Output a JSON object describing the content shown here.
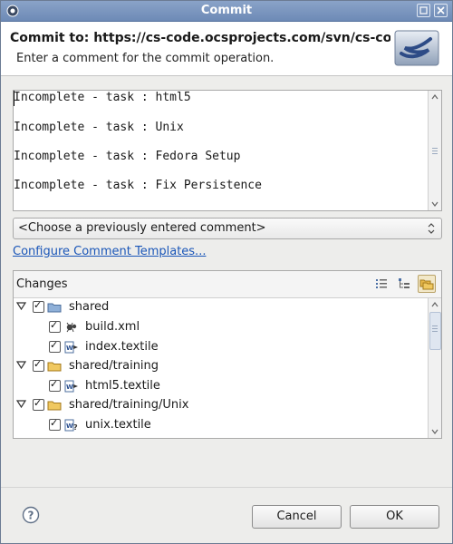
{
  "window": {
    "title": "Commit"
  },
  "header": {
    "title": "Commit to: https://cs-code.ocsprojects.com/svn/cs-code/tı",
    "description": "Enter a comment for the commit operation."
  },
  "comment": {
    "lines": [
      "Incomplete - task : html5",
      "Incomplete - task : Unix",
      "Incomplete - task : Fedora Setup",
      "Incomplete - task : Fix Persistence"
    ]
  },
  "previous_comment": {
    "selected": "<Choose a previously entered comment>"
  },
  "links": {
    "configure_templates": "Configure Comment Templates..."
  },
  "changes": {
    "title": "Changes",
    "rows": [
      {
        "label": "shared",
        "type": "folder",
        "level": 0,
        "checked": true,
        "expanded": true,
        "icon": "folder-icon"
      },
      {
        "label": "build.xml",
        "type": "file",
        "level": 1,
        "checked": true,
        "icon": "ant-file-icon"
      },
      {
        "label": "index.textile",
        "type": "file",
        "level": 1,
        "checked": true,
        "icon": "word-file-modified-icon"
      },
      {
        "label": "shared/training",
        "type": "folder",
        "level": 0,
        "checked": true,
        "expanded": true,
        "icon": "folder-icon"
      },
      {
        "label": "html5.textile",
        "type": "file",
        "level": 1,
        "checked": true,
        "icon": "word-file-modified-icon"
      },
      {
        "label": "shared/training/Unix",
        "type": "folder",
        "level": 0,
        "checked": true,
        "expanded": true,
        "icon": "folder-icon"
      },
      {
        "label": "unix.textile",
        "type": "file",
        "level": 1,
        "checked": true,
        "icon": "word-file-unversioned-icon"
      }
    ]
  },
  "buttons": {
    "cancel": "Cancel",
    "ok": "OK"
  },
  "colors": {
    "titlebar": "#7b96bf",
    "link": "#1a56b8",
    "folder": "#e8b84a"
  }
}
